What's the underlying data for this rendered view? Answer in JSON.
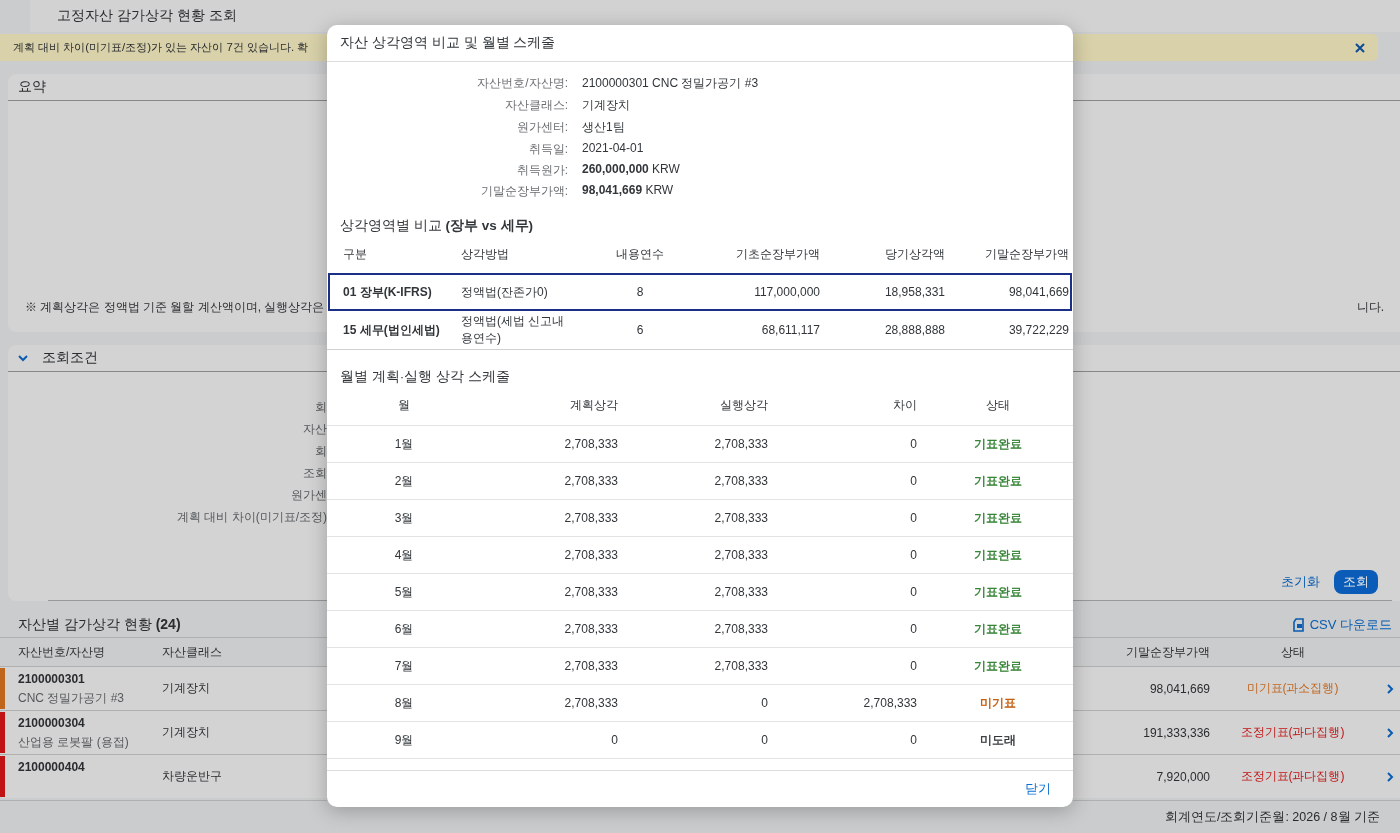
{
  "page": {
    "title": "고정자산 감가상각 현황 조회"
  },
  "alert": {
    "message": "계획 대비 차이(미기표/조정)가 있는 자산이 7건 있습니다. 확"
  },
  "summary": {
    "title": "요약",
    "note_left": "※ 계획상각은 정액법 기준 월할 계산액이며, 실행상각은",
    "note_right": "니다."
  },
  "filters": {
    "title": "조회조건",
    "expanded": true,
    "labels": [
      "회",
      "자산",
      "회",
      "조회",
      "원가센",
      "계획 대비 차이(미기표/조정)"
    ],
    "reset": "초기화",
    "search": "조회"
  },
  "asset_table": {
    "title": "자산별 감가상각 현황 **(24)**",
    "csv": "CSV 다운로드",
    "columns_left": [
      "자산번호/자산명",
      "자산클래스"
    ],
    "columns_right": [
      "기말순장부가액",
      "상태"
    ],
    "rows": [
      {
        "number": "2100000301",
        "name": "CNC 정밀가공기 #3",
        "class": "기계장치",
        "closing": "98,041,669",
        "status": "미기표(과소집행)",
        "color": "#c0651c"
      },
      {
        "number": "2100000304",
        "name": "산업용 로봇팔 (용접)",
        "class": "기계장치",
        "closing": "191,333,336",
        "status": "조정기표(과다집행)",
        "color": "#c01414"
      },
      {
        "number": "2100000404",
        "class": "차량운반구",
        "closing": "7,920,000",
        "status": "조정기표(과다집행)",
        "color": "#c01414"
      }
    ]
  },
  "footer": "회계연도/조회기준월: 2026 / 8월 기준",
  "dialog": {
    "title": "자산 상각영역 비교 및 월별 스케줄",
    "info": [
      {
        "label": "자산번호/자산명:",
        "value": "2100000301 CNC 정밀가공기 #3"
      },
      {
        "label": "자산클래스:",
        "value": "기계장치"
      },
      {
        "label": "원가센터:",
        "value": "생산1팀"
      },
      {
        "label": "취득일:",
        "value": "2021-04-01"
      },
      {
        "label": "취득원가:",
        "value": "**260,000,000** KRW"
      },
      {
        "label": "기말순장부가액:",
        "value": "**98,041,669** KRW"
      }
    ],
    "compare": {
      "title": "상각영역별 비교 **(장부 vs 세무)**",
      "columns": [
        "구분",
        "상각방법",
        "내용연수",
        "기초순장부가액",
        "당기상각액",
        "기말순장부가액"
      ],
      "rows": [
        {
          "cells": [
            "01 장부(K-IFRS)",
            "정액법(잔존가0)",
            "8",
            "117,000,000",
            "18,958,331",
            "98,041,669"
          ],
          "selected": true
        },
        {
          "cells": [
            "15 세무(법인세법)",
            "정액법(세법 신고내용연수)",
            "6",
            "68,611,117",
            "28,888,888",
            "39,722,229"
          ],
          "selected": false
        }
      ]
    },
    "schedule": {
      "title": "월별 계획·실행 상각 스케줄",
      "columns": [
        "월",
        "계획상각",
        "실행상각",
        "차이",
        "상태"
      ],
      "rows": [
        {
          "month": "1월",
          "plan": "2,708,333",
          "actual": "2,708,333",
          "diff": "0",
          "status": "기표완료",
          "color": "#2b7d2b"
        },
        {
          "month": "2월",
          "plan": "2,708,333",
          "actual": "2,708,333",
          "diff": "0",
          "status": "기표완료",
          "color": "#2b7d2b"
        },
        {
          "month": "3월",
          "plan": "2,708,333",
          "actual": "2,708,333",
          "diff": "0",
          "status": "기표완료",
          "color": "#2b7d2b"
        },
        {
          "month": "4월",
          "plan": "2,708,333",
          "actual": "2,708,333",
          "diff": "0",
          "status": "기표완료",
          "color": "#2b7d2b"
        },
        {
          "month": "5월",
          "plan": "2,708,333",
          "actual": "2,708,333",
          "diff": "0",
          "status": "기표완료",
          "color": "#2b7d2b"
        },
        {
          "month": "6월",
          "plan": "2,708,333",
          "actual": "2,708,333",
          "diff": "0",
          "status": "기표완료",
          "color": "#2b7d2b"
        },
        {
          "month": "7월",
          "plan": "2,708,333",
          "actual": "2,708,333",
          "diff": "0",
          "status": "기표완료",
          "color": "#2b7d2b"
        },
        {
          "month": "8월",
          "plan": "2,708,333",
          "actual": "0",
          "diff": "2,708,333",
          "status": "미기표",
          "color": "#c35500"
        },
        {
          "month": "9월",
          "plan": "0",
          "actual": "0",
          "diff": "0",
          "status": "미도래",
          "color": "#32363a"
        }
      ]
    },
    "close": "닫기"
  }
}
